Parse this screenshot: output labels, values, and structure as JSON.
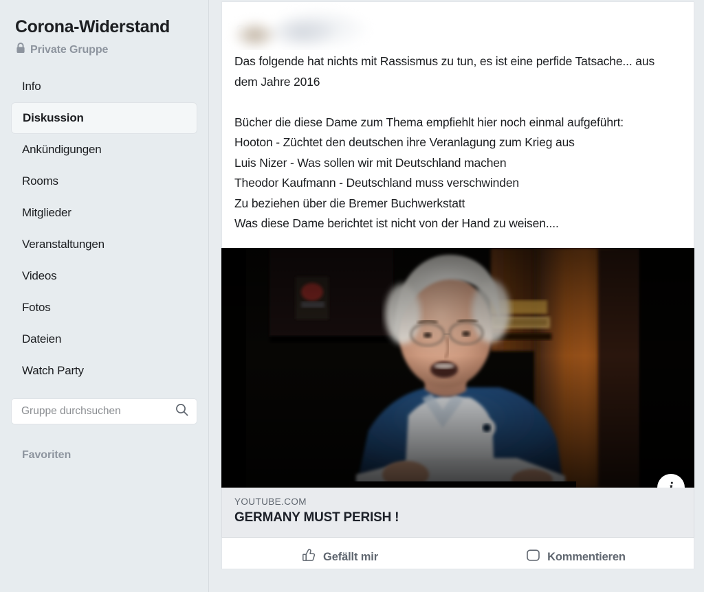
{
  "sidebar": {
    "group_title": "Corona-Widerstand",
    "privacy_label": "Private Gruppe",
    "privacy_icon": "lock-icon",
    "nav_items": [
      {
        "label": "Info",
        "active": false
      },
      {
        "label": "Diskussion",
        "active": true
      },
      {
        "label": "Ankündigungen",
        "active": false
      },
      {
        "label": "Rooms",
        "active": false
      },
      {
        "label": "Mitglieder",
        "active": false
      },
      {
        "label": "Veranstaltungen",
        "active": false
      },
      {
        "label": "Videos",
        "active": false
      },
      {
        "label": "Fotos",
        "active": false
      },
      {
        "label": "Dateien",
        "active": false
      },
      {
        "label": "Watch Party",
        "active": false
      }
    ],
    "search": {
      "placeholder": "Gruppe durchsuchen",
      "value": "",
      "icon": "search-icon"
    },
    "favorites_label": "Favoriten"
  },
  "post": {
    "author_name_visible": "Gruf",
    "author_blurred": true,
    "body": "Das folgende hat nichts mit Rassismus zu tun, es ist eine perfide Tatsache... aus dem Jahre 2016\n\nBücher die diese Dame zum Thema empfiehlt hier noch einmal aufgeführt:\nHooton - Züchtet den deutschen ihre Veranlagung zum Krieg aus\nLuis Nizer - Was sollen wir mit Deutschland machen\nTheodor Kaufmann - Deutschland muss verschwinden\nZu beziehen über die Bremer Buchwerkstatt\nWas diese Dame berichtet ist nicht von der Hand zu weisen....",
    "attachment": {
      "thumbnail_alt": "Ältere Frau in blauem Blazer und weißer Bluse spricht vor dunklem Bücherregal",
      "info_badge_label": "i",
      "domain": "YOUTUBE.COM",
      "title": "GERMANY MUST PERISH !"
    },
    "actions": [
      {
        "label": "Gefällt mir",
        "icon": "thumbs-up-icon"
      },
      {
        "label": "Kommentieren",
        "icon": "comment-bubble-icon"
      }
    ]
  },
  "colors": {
    "sidebar_bg": "#e7ecef",
    "page_bg": "#e8ecef",
    "card_bg": "#ffffff",
    "link_meta_bg": "#e9ebee",
    "link_color": "#385898",
    "muted_text": "#8d949e",
    "primary_text": "#1c1e21"
  }
}
